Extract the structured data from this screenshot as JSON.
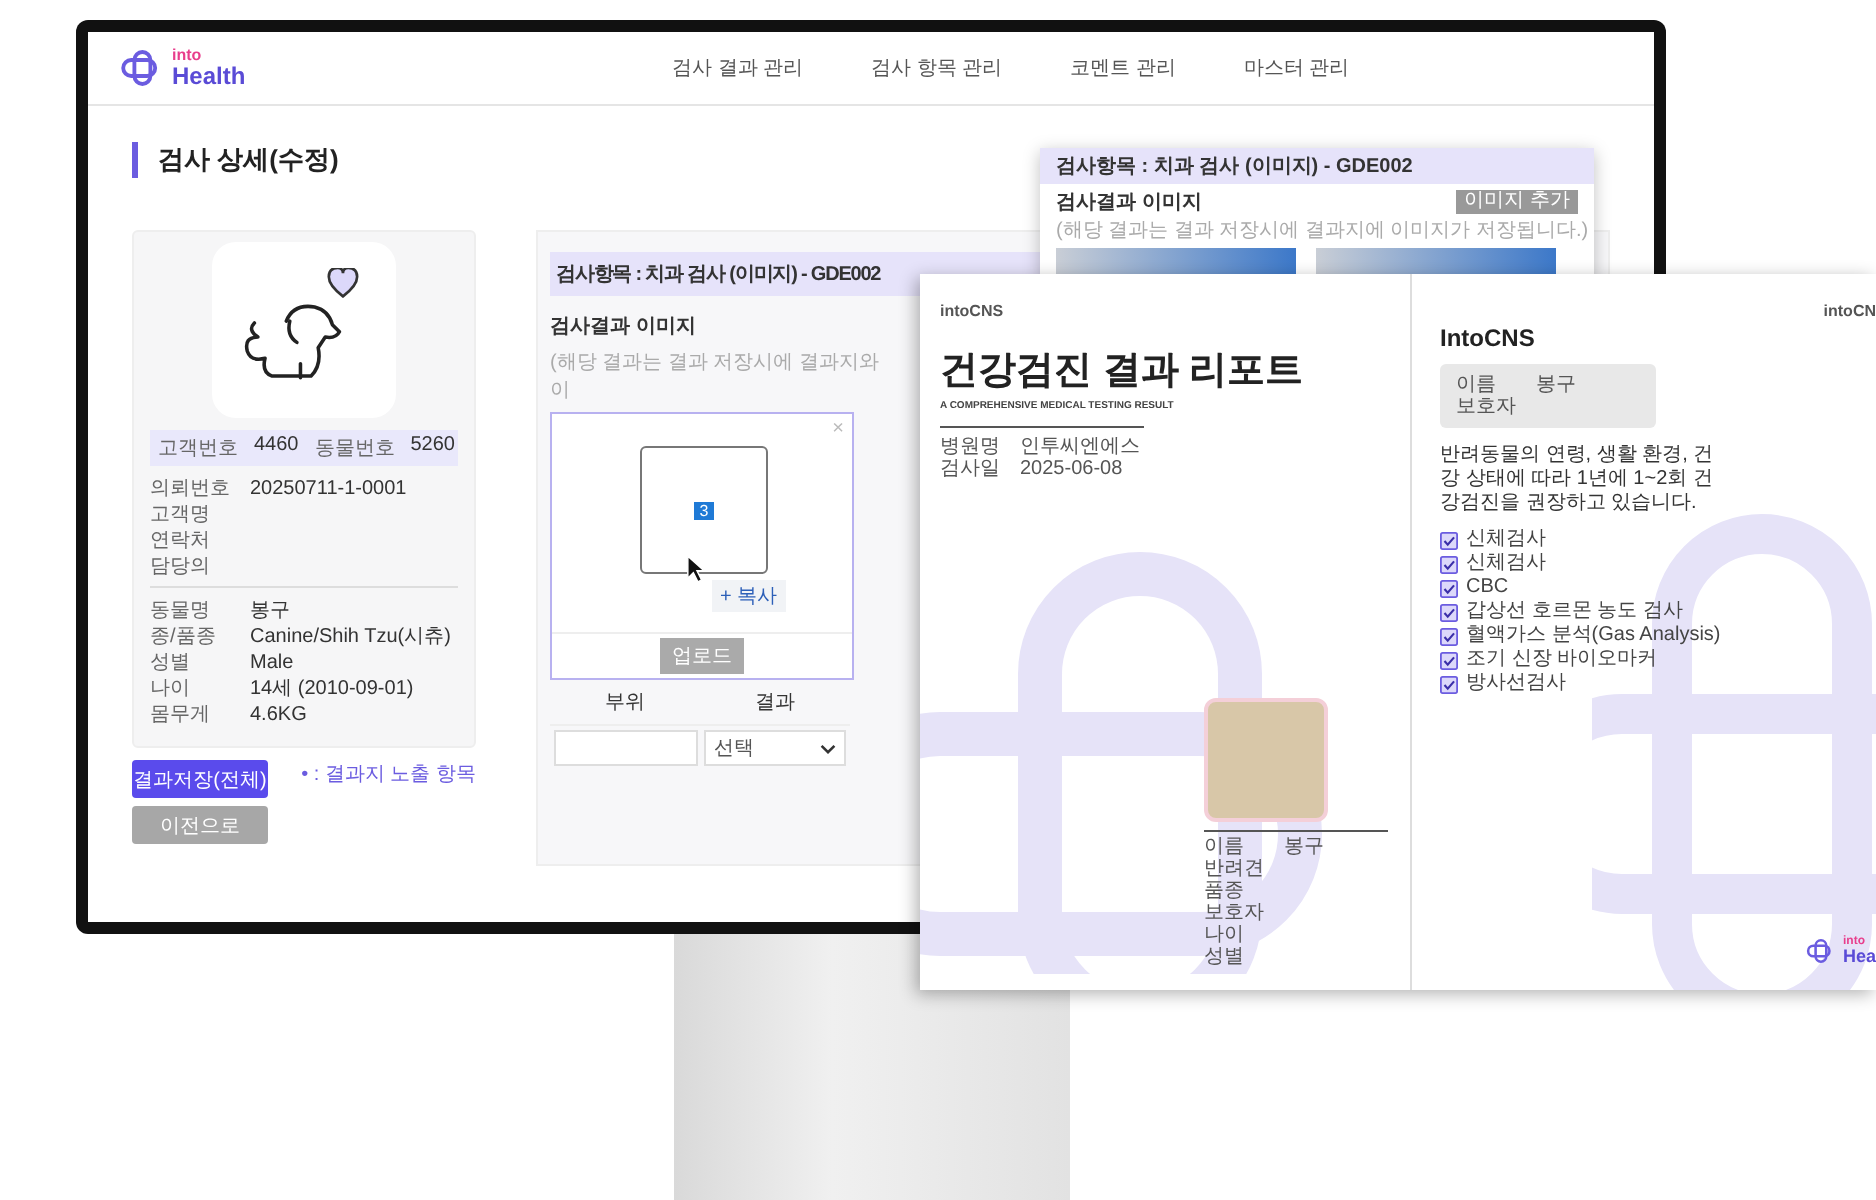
{
  "header": {
    "logo": {
      "small": "into",
      "large": "Health"
    },
    "nav": [
      "검사 결과 관리",
      "검사 항목 관리",
      "코멘트 관리",
      "마스터 관리"
    ]
  },
  "page_title": "검사 상세(수정)",
  "patient_card": {
    "ids": [
      {
        "label": "고객번호",
        "value": "4460"
      },
      {
        "label": "동물번호",
        "value": "5260"
      }
    ],
    "request_fields": [
      {
        "label": "의뢰번호",
        "value": "20250711-1-0001"
      },
      {
        "label": "고객명"
      },
      {
        "label": "연락처"
      },
      {
        "label": "담당의"
      }
    ],
    "animal_fields": [
      {
        "label": "동물명",
        "value": "봉구"
      },
      {
        "label": "종/품종",
        "value": "Canine/Shih Tzu(시츄)"
      },
      {
        "label": "성별",
        "value": "Male"
      },
      {
        "label": "나이",
        "value": "14세 (2010-09-01)"
      },
      {
        "label": "몸무게",
        "value": "4.6KG"
      }
    ]
  },
  "buttons": [
    {
      "label": "결과저장(전체)",
      "kind": "primary"
    },
    {
      "label": "이전으로",
      "kind": "secondary"
    }
  ],
  "legend": "• : 결과지 노출 항목",
  "test_panel": {
    "header": "검사항목 : 치과 검사 (이미지) - GDE002",
    "image_label": "검사결과 이미지",
    "image_hint": "(해당 결과는 결과 저장시에 결과지와 이",
    "close": "×",
    "image_count": "3",
    "copy_button": "+ 복사",
    "upload_button": "업로드",
    "columns": [
      "부위",
      "결과"
    ],
    "result_placeholder": "선택"
  },
  "popup": {
    "header": "검사항목 : 치과 검사 (이미지) - GDE002",
    "image_label": "검사결과 이미지",
    "image_hint": "(해당 결과는 결과 저장시에 결과지에 이미지가 저장됩니다.)",
    "add_button": "이미지 추가"
  },
  "report": {
    "cover": {
      "brand": "intoCNS",
      "title": "건강검진 결과 리포트",
      "subtitle": "A COMPREHENSIVE MEDICAL TESTING RESULT",
      "meta": [
        {
          "label": "병원명",
          "value": "인투씨엔에스"
        },
        {
          "label": "검사일",
          "value": "2025-06-08"
        }
      ],
      "pet_fields": [
        {
          "label": "이름",
          "value": "봉구"
        },
        {
          "label": "반려견"
        },
        {
          "label": "품종"
        },
        {
          "label": "보호자"
        },
        {
          "label": "나이"
        },
        {
          "label": "성별"
        }
      ]
    },
    "intro": {
      "brand": "intoCN",
      "title": "IntoCNS",
      "fields": [
        {
          "label": "이름",
          "value": "봉구"
        },
        {
          "label": "보호자"
        }
      ],
      "paragraph": "반려동물의 연령, 생활 환경, 건강 상태에 따라 1년에 1~2회 건강검진을 권장하고 있습니다.",
      "checklist": [
        {
          "label": "신체검사",
          "checked": true
        },
        {
          "label": "신체검사",
          "checked": true
        },
        {
          "label": "CBC",
          "checked": true
        },
        {
          "label": "갑상선 호르몬 농도 검사",
          "checked": true
        },
        {
          "label": "혈액가스 분석(Gas Analysis)",
          "checked": true
        },
        {
          "label": "조기 신장 바이오마커",
          "checked": true
        },
        {
          "label": "방사선검사",
          "checked": true
        }
      ],
      "footer_logo": {
        "small": "into",
        "large": "Hea"
      }
    }
  }
}
